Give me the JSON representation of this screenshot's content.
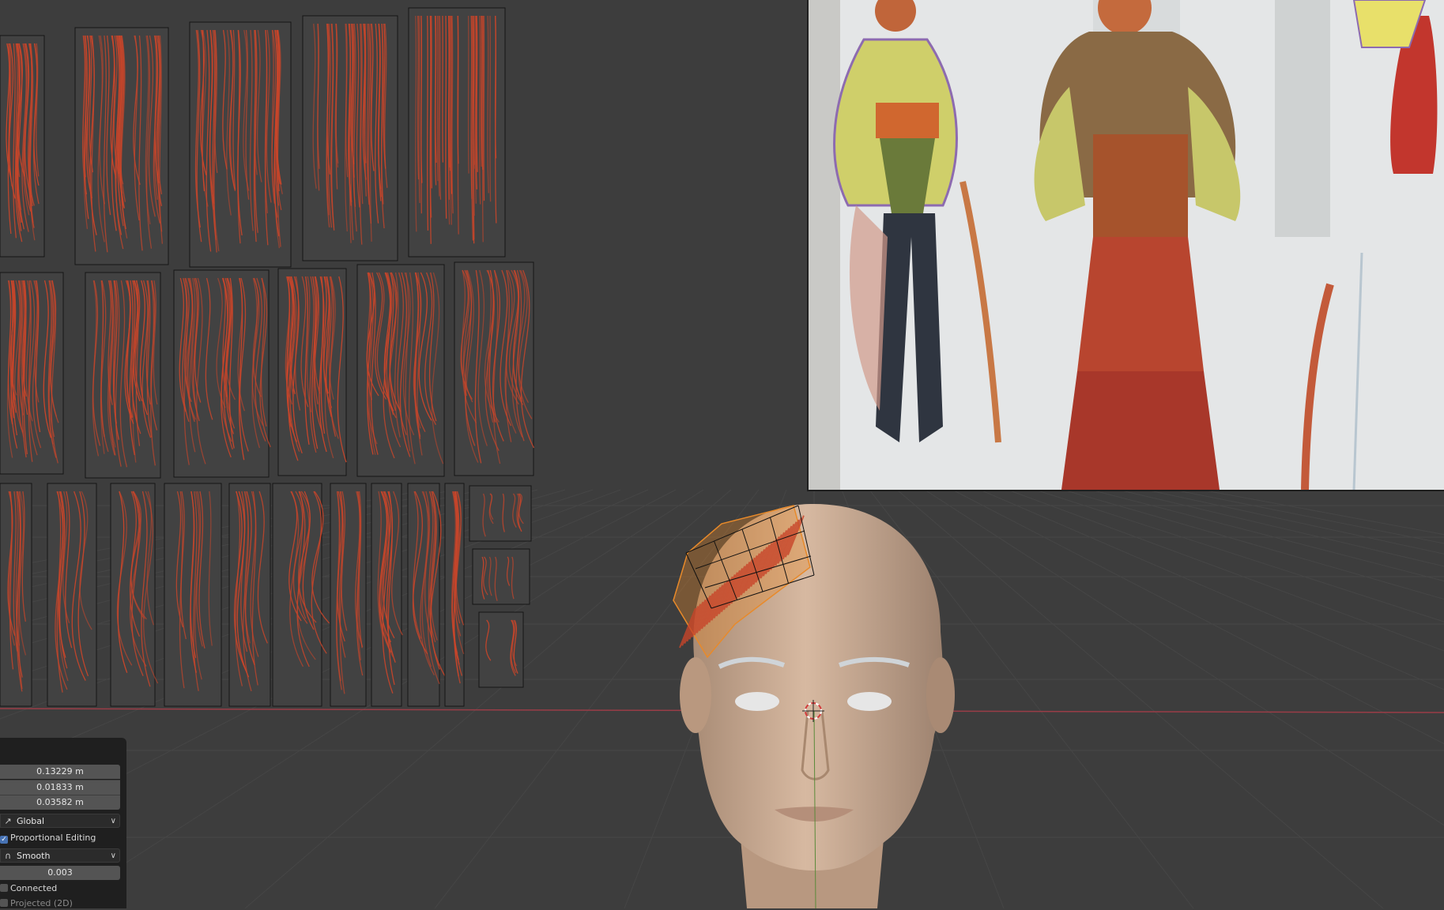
{
  "app": "Blender 3D viewport",
  "operator_panel": {
    "values": [
      "0.13229 m",
      "0.01833 m",
      "0.03582 m"
    ],
    "orientation": {
      "label": "Global",
      "icon": "orientation-icon"
    },
    "proportional_editing": {
      "label": "Proportional Editing",
      "checked": true
    },
    "falloff": {
      "label": "Smooth",
      "icon": "falloff-curve-icon"
    },
    "size_value": "0.003",
    "connected": {
      "label": "Connected",
      "checked": false
    },
    "projected": {
      "label": "Projected (2D)",
      "checked": false
    }
  },
  "colors": {
    "viewport_bg": "#3d3d3d",
    "hair": "#c8452a",
    "selection": "#e88a2a",
    "skin": "#c9a88f",
    "x_axis": "#9a3d47",
    "panel_bg": "#1f1f1f",
    "field_bg": "#545454",
    "checkbox_on": "#4772b3"
  }
}
